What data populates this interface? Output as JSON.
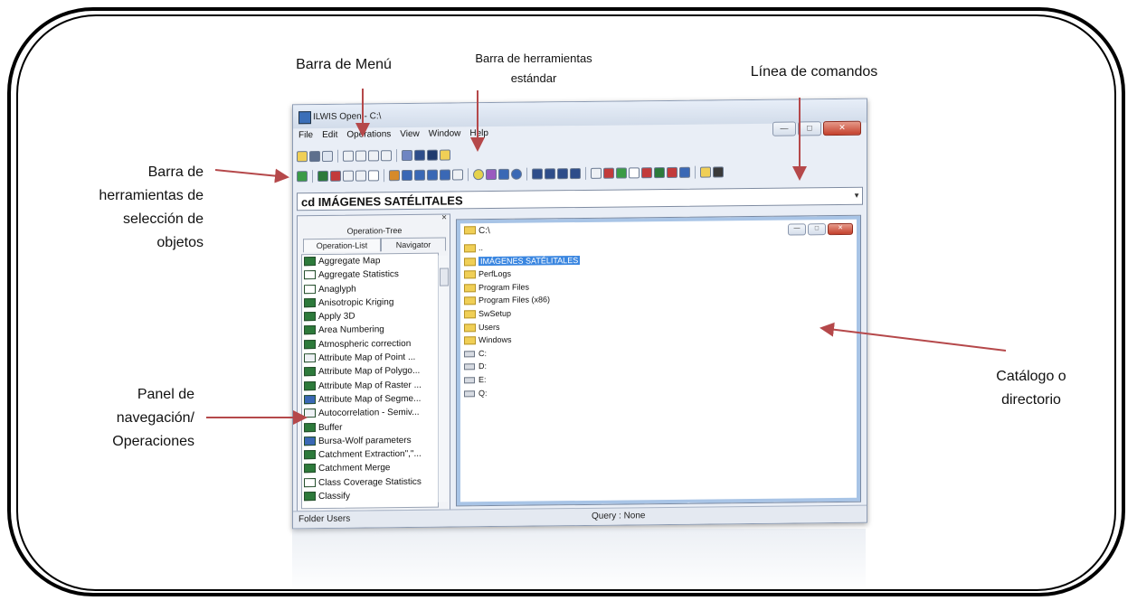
{
  "callouts": {
    "menu_bar": "Barra de Menú",
    "std_toolbar": "Barra de herramientas\nestándar",
    "command_line": "Línea de comandos",
    "object_toolbar": "Barra de\nherramientas de\nselección de\nobjetos",
    "nav_panel": "Panel de\nnavegación/\nOperaciones",
    "catalog": "Catálogo o\ndirectorio"
  },
  "window": {
    "title": "ILWIS Open - C:\\",
    "minimize": "—",
    "maximize": "□",
    "close": "✕"
  },
  "menu": [
    "File",
    "Edit",
    "Operations",
    "View",
    "Window",
    "Help"
  ],
  "command_line": "cd IMÁGENES SATÉLITALES",
  "nav": {
    "close": "×",
    "tab_tree": "Operation-Tree",
    "tab_list": "Operation-List",
    "tab_navigator": "Navigator",
    "operations": [
      "Aggregate Map",
      "Aggregate Statistics",
      "Anaglyph",
      "Anisotropic Kriging",
      "Apply 3D",
      "Area Numbering",
      "Atmospheric correction",
      "Attribute Map of Point ...",
      "Attribute Map of Polygo...",
      "Attribute Map of Raster ...",
      "Attribute Map of Segme...",
      "Autocorrelation - Semiv...",
      "Buffer",
      "Bursa-Wolf parameters",
      "Catchment Extraction\",\"...",
      "Catchment Merge",
      "Class Coverage Statistics",
      "Classify"
    ]
  },
  "catalog": {
    "title": "C:\\",
    "items": [
      {
        "label": "..",
        "type": "folder"
      },
      {
        "label": "IMÁGENES SATÉLITALES",
        "type": "folder",
        "selected": true
      },
      {
        "label": "PerfLogs",
        "type": "folder"
      },
      {
        "label": "Program Files",
        "type": "folder"
      },
      {
        "label": "Program Files (x86)",
        "type": "folder"
      },
      {
        "label": "SwSetup",
        "type": "folder"
      },
      {
        "label": "Users",
        "type": "folder"
      },
      {
        "label": "Windows",
        "type": "folder"
      },
      {
        "label": "C:",
        "type": "drive"
      },
      {
        "label": "D:",
        "type": "drive"
      },
      {
        "label": "E:",
        "type": "drive"
      },
      {
        "label": "Q:",
        "type": "drive"
      }
    ]
  },
  "status": {
    "folder": "Folder Users",
    "query": "Query : None"
  }
}
